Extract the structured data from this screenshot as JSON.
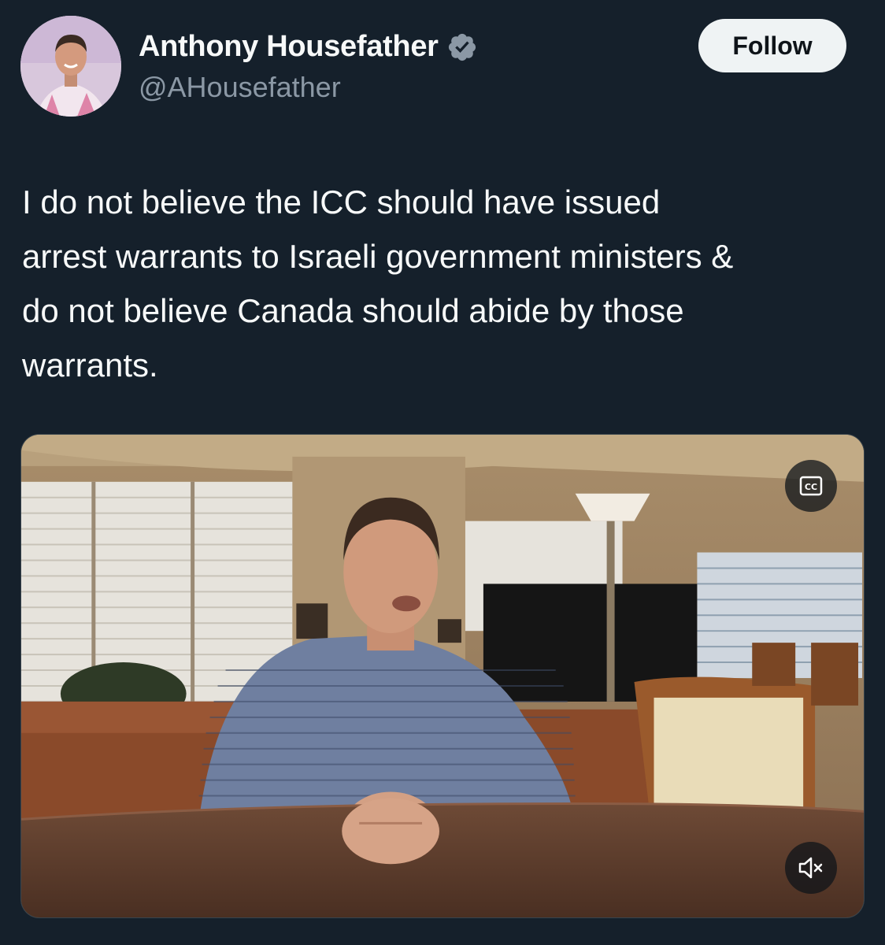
{
  "author": {
    "name": "Anthony Housefather",
    "handle": "@AHousefather",
    "verified_icon": "verified-badge-icon",
    "avatar": "profile-photo"
  },
  "follow_button": {
    "label": "Follow"
  },
  "tweet": {
    "text": "I do not believe the ICC should have issued\narrest warrants to Israeli government ministers &\ndo not believe Canada should abide by those\nwarrants."
  },
  "video": {
    "description_icon": "video-thumbnail",
    "controls": {
      "captions_icon": "closed-captions-icon",
      "mute_icon": "speaker-muted-icon"
    }
  },
  "colors": {
    "background": "#15202b",
    "text_primary": "#f7f9f9",
    "text_secondary": "#8b98a5",
    "verified": "#8b98a5",
    "follow_bg": "#eff3f4"
  }
}
